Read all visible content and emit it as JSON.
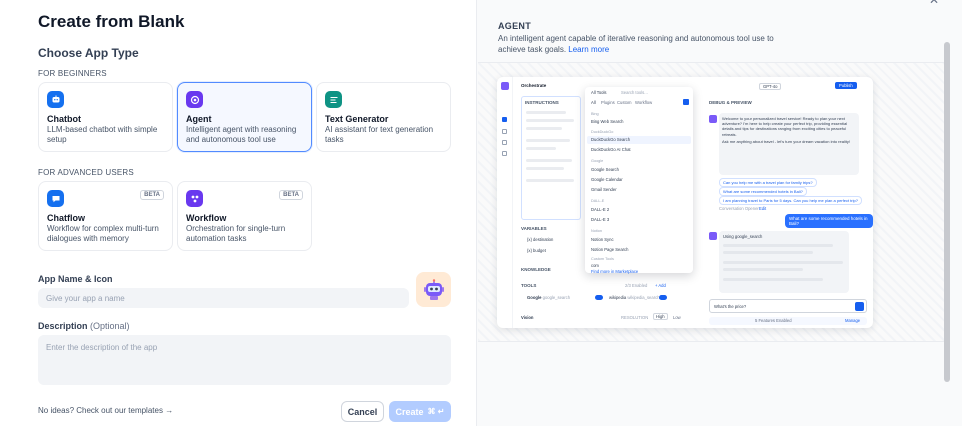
{
  "dialog": {
    "title": "Create from Blank",
    "choose_type_label": "Choose App Type",
    "beginners_label": "FOR BEGINNERS",
    "advanced_label": "FOR ADVANCED USERS",
    "app_types": [
      {
        "name": "Chatbot",
        "desc": "LLM-based chatbot with simple setup",
        "color": "#1570ef"
      },
      {
        "name": "Agent",
        "desc": "Intelligent agent with reasoning and autonomous tool use",
        "color": "#6938ef",
        "selected": true
      },
      {
        "name": "Text Generator",
        "desc": "AI assistant for text generation tasks",
        "color": "#0e9384"
      },
      {
        "name": "Chatflow",
        "desc": "Workflow for complex multi-turn dialogues with memory",
        "color": "#1570ef",
        "badge": "BETA"
      },
      {
        "name": "Workflow",
        "desc": "Orchestration for single-turn automation tasks",
        "color": "#6938ef",
        "badge": "BETA"
      }
    ],
    "name_label": "App Name & Icon",
    "name_placeholder": "Give your app a name",
    "description_label": "Description",
    "description_optional": "(Optional)",
    "description_placeholder": "Enter the description of the app",
    "templates_link": "No ideas? Check out our templates",
    "cancel_label": "Cancel",
    "create_label": "Create"
  },
  "preview": {
    "title": "AGENT",
    "desc": "An intelligent agent capable of iterative reasoning and autonomous tool use to achieve task goals.",
    "learn_more": "Learn more",
    "mock": {
      "app_name": "Orchestrate",
      "instructions_label": "INSTRUCTIONS",
      "variables_label": "VARIABLES",
      "knowledge_label": "KNOWLEDGE",
      "tools_label": "TOOLS",
      "vision_label": "Vision",
      "resolution_label": "RESOLUTION",
      "res_high": "High",
      "res_low": "Low",
      "var_destination": "{x} destination",
      "var_budget": "{x} budget",
      "tool_google": "Google",
      "tool_google_search": "google_search",
      "tool_wikipedia": "wikipedia",
      "tool_wiki_search": "wikipedia_search",
      "tools_count": "2/3 Enabled",
      "add_label": "+ Add",
      "all_tools": "All Tools",
      "search_tools": "Search tools...",
      "filter_tabs": [
        "All",
        "Plugins",
        "Custom",
        "Workflow"
      ],
      "tool_groups": [
        {
          "group": "Bing",
          "items": [
            "Bing Web Search"
          ]
        },
        {
          "group": "DuckDuckGo",
          "items": [
            "DuckDuckGo Search",
            "DuckDuckGo AI Chat"
          ]
        },
        {
          "group": "Google",
          "items": [
            "Google Search",
            "Google Calendar",
            "Gmail Sender"
          ]
        },
        {
          "group": "DALL-E",
          "items": [
            "DALL-E 2",
            "DALL-E 3"
          ]
        },
        {
          "group": "Notion",
          "items": [
            "Notion Sync",
            "Notion Page Search"
          ]
        },
        {
          "group": "Custom Tools",
          "items": [
            "com"
          ]
        }
      ],
      "find_more": "Find more in Marketplace",
      "model_name": "GPT-4o",
      "publish": "Publish",
      "debug_label": "DEBUG & PREVIEW",
      "welcome_msg": "Welcome to your personalized travel service! Ready to plan your next adventure? I'm here to help create your perfect trip, providing essential details and tips for destinations ranging from exciting cities to peaceful retreats.",
      "ask_msg": "Ask me anything about travel - let's turn your dream vacation into reality!",
      "suggestions": [
        "Can you help me with a travel plan for family trips?",
        "What are some recommended hotels in Bali?",
        "I am planning travel to Paris for 5 days. Can you help me plan a perfect trip?"
      ],
      "conv_opener": "Conversation Opener",
      "edit": "Edit",
      "user_msg": "What are some recommended hotels in Bali?",
      "using": "Using",
      "using_tool": "google_search",
      "input_text": "What's the price?",
      "features": "5 Features Enabled",
      "manage": "Manage"
    }
  }
}
